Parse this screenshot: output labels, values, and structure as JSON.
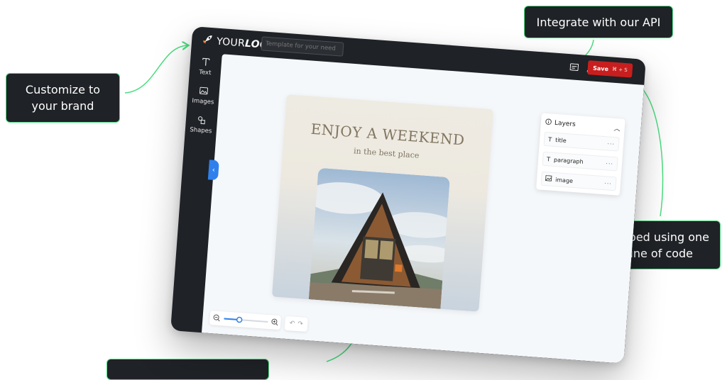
{
  "callouts": {
    "brand": "Customize to your brand",
    "api": "Integrate with our API",
    "embed": "Embed using one line of code"
  },
  "editor": {
    "logo": {
      "regular": "YOUR",
      "bold": "LOGO"
    },
    "template_placeholder": "Template for your need",
    "save_label": "Save",
    "save_shortcut": "⌘ + S",
    "sidebar": [
      {
        "label": "Text",
        "icon": "text-icon"
      },
      {
        "label": "Images",
        "icon": "image-icon"
      },
      {
        "label": "Shapes",
        "icon": "shapes-icon"
      }
    ],
    "card": {
      "title": "ENJOY A WEEKEND",
      "subtitle": "in the best place"
    },
    "layers": {
      "header": "Layers",
      "items": [
        {
          "label": "title",
          "icon": "text-icon"
        },
        {
          "label": "paragraph",
          "icon": "text-icon"
        },
        {
          "label": "image",
          "icon": "image-icon"
        }
      ]
    },
    "zoom_level": 0.35
  },
  "colors": {
    "accent_green": "#4ade80",
    "save_red": "#c81e1e",
    "panel_dark": "#1f2226",
    "toggle_blue": "#2f80ed"
  }
}
